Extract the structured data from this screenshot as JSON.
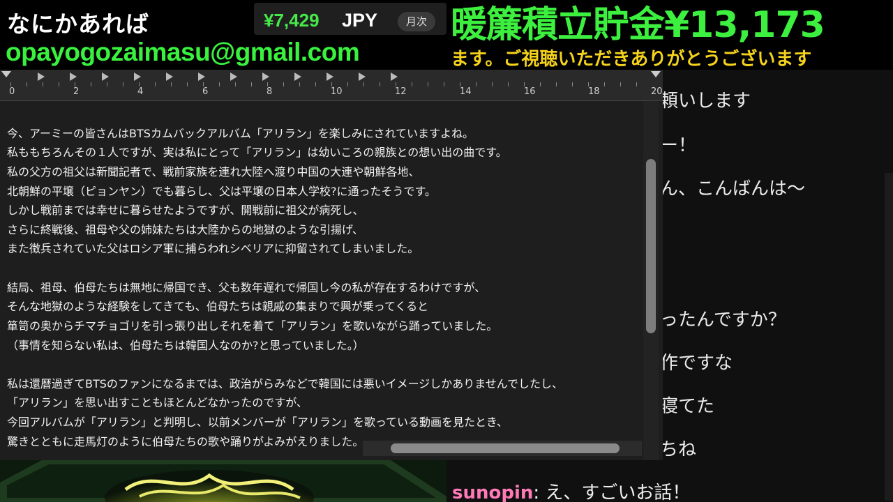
{
  "overlay": {
    "contact_title": "なにかあれば",
    "contact_email": "opayogozaimasu@gmail.com"
  },
  "currency": {
    "amount": "¥7,429",
    "code": "JPY",
    "period": "月次"
  },
  "savings": {
    "text": "暖簾積立貯金¥13,173"
  },
  "ticker": {
    "text": "ます。ご視聴いただきありがとうございます"
  },
  "ruler": {
    "numbers": [
      "0",
      "2",
      "4",
      "6",
      "8",
      "10",
      "12",
      "14",
      "16",
      "18",
      "20"
    ]
  },
  "document": {
    "lines": [
      "今、アーミーの皆さんはBTSカムバックアルバム「アリラン」を楽しみにされていますよね。",
      "私ももちろんその１人ですが、実は私にとって「アリラン」は幼いころの親族との想い出の曲です。",
      "私の父方の祖父は新聞記者で、戦前家族を連れ大陸へ渡り中国の大連や朝鮮各地、",
      "北朝鮮の平壌（ピョンヤン）でも暮らし、父は平壌の日本人学校?に通ったそうです。",
      "しかし戦前までは幸せに暮らせたようですが、開戦前に祖父が病死し、",
      "さらに終戦後、祖母や父の姉妹たちは大陸からの地獄のような引揚げ、",
      "また徴兵されていた父はロシア軍に捕らわれシベリアに抑留されてしまいました。",
      "",
      "結局、祖母、伯母たちは無地に帰国でき、父も数年遅れで帰国し今の私が存在するわけですが、",
      "そんな地獄のような経験をしてきても、伯母たちは親戚の集まりで興が乗ってくると",
      "箪笥の奥からチマチョゴリを引っ張り出しそれを着て「アリラン」を歌いながら踊っていました。",
      "（事情を知らない私は、伯母たちは韓国人なのか?と思っていました。）",
      "",
      "私は還暦過ぎてBTSのファンになるまでは、政治がらみなどで韓国には悪いイメージしかありませんでしたし、",
      "「アリラン」を思い出すこともほとんどなかったのですが、",
      "今回アルバムが「アリラン」と判明し、以前メンバーが「アリラン」を歌っている動画を見たとき、",
      "驚きとともに走馬灯のように伯母たちの歌や踊りがよみがえりました。"
    ]
  },
  "chat": {
    "lines": [
      "頼いします",
      "ー！",
      "ん、こんばんは〜",
      "ったんですか？",
      "作ですな",
      "寝てた",
      "ちね"
    ],
    "last_user": "sunopin",
    "last_message": "え、すごいお話！"
  },
  "colors": {
    "green": "#3df03f",
    "yellow": "#f5d21c",
    "pink": "#ff7ab8"
  }
}
